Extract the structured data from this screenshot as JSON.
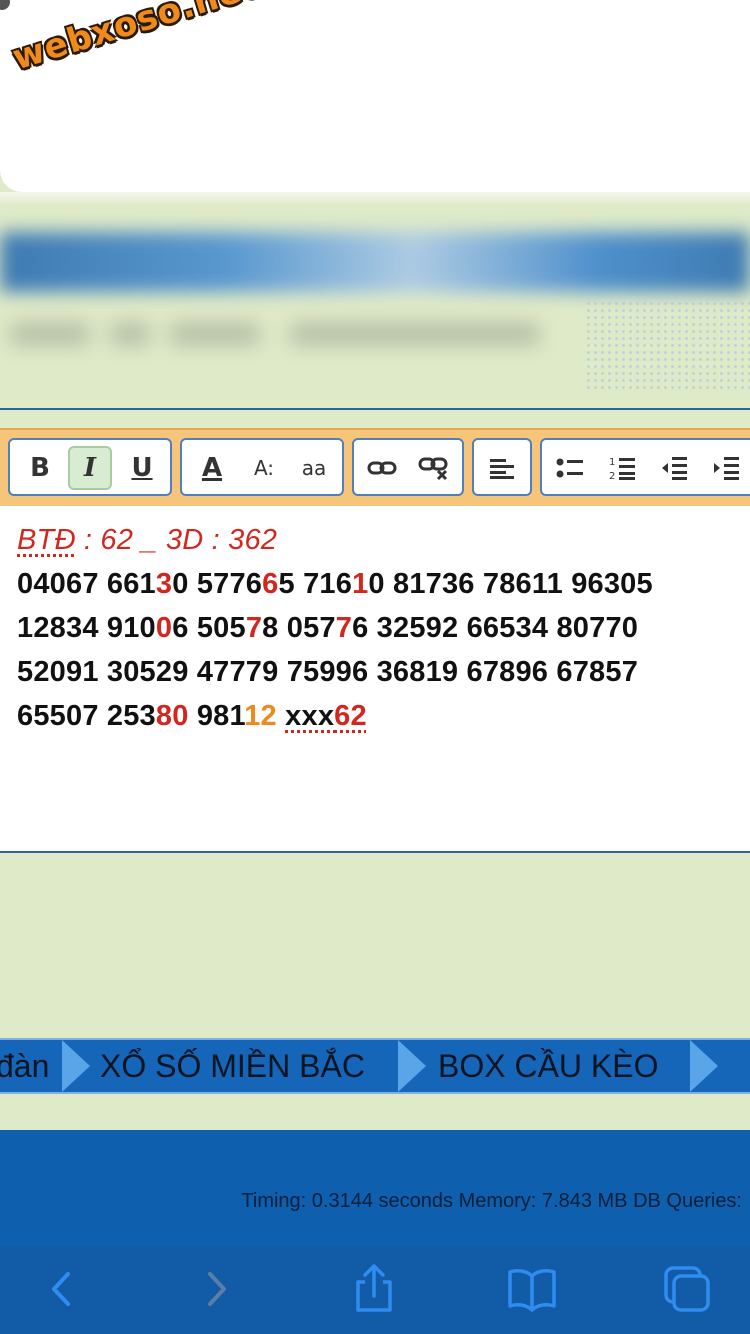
{
  "header": {
    "logo_text": "webxoso.net"
  },
  "toolbar": {
    "groups": [
      {
        "name": "text-style",
        "buttons": [
          {
            "label": "B",
            "icon": "bold-icon"
          },
          {
            "label": "I",
            "icon": "italic-icon",
            "active": true
          },
          {
            "label": "U",
            "icon": "underline-icon"
          }
        ]
      },
      {
        "name": "font",
        "buttons": [
          {
            "label": "A",
            "icon": "font-color-icon"
          },
          {
            "label": "A:",
            "icon": "font-size-icon"
          },
          {
            "label": "aa",
            "icon": "font-family-icon"
          }
        ]
      },
      {
        "name": "link",
        "buttons": [
          {
            "icon": "link-icon"
          },
          {
            "icon": "unlink-icon"
          }
        ]
      },
      {
        "name": "align",
        "buttons": [
          {
            "icon": "align-left-icon"
          }
        ]
      },
      {
        "name": "list",
        "buttons": [
          {
            "icon": "bullet-list-icon"
          },
          {
            "icon": "numbered-list-icon"
          },
          {
            "icon": "outdent-icon"
          },
          {
            "icon": "indent-icon"
          }
        ]
      }
    ]
  },
  "editor": {
    "header_line": {
      "btd": "BTĐ",
      "rest": " : 62 _ 3D : 362"
    },
    "line1": {
      "a": "04067 661",
      "b": "3",
      "c": "0 5776",
      "d": "6",
      "e": "5 716",
      "f": "1",
      "g": "0 81736 78611 96305"
    },
    "line2": {
      "a": "12834 910",
      "b": "0",
      "c": "6 505",
      "d": "7",
      "e": "8 057",
      "f": "7",
      "g": "6 32592 66534 80770"
    },
    "line3": "52091 30529 47779 75996 36819 67896 67857",
    "line4": {
      "a": "65507 253",
      "b": "80",
      "c": " 981",
      "d": "12",
      "e": " ",
      "f": "xxx",
      "g": "62"
    },
    "colors": {
      "highlight_red": "#d3261f",
      "highlight_orange": "#ec8a1e"
    }
  },
  "nav": {
    "items": [
      {
        "label": "đàn"
      },
      {
        "label": "XỔ SỐ MIỀN BẮC"
      },
      {
        "label": "BOX CẦU KÈO"
      }
    ]
  },
  "footer": {
    "timing_text": "Timing: 0.3144 seconds Memory: 7.843 MB DB Queries:"
  },
  "browser_bar": {
    "buttons": [
      "back-icon",
      "forward-icon",
      "share-icon",
      "bookmarks-icon",
      "tabs-icon"
    ]
  },
  "theme": {
    "page_bg": "#dfeac8",
    "toolbar_bg": "#f6c57a",
    "nav_bg": "#1565b8",
    "footer_bg": "#0e5fae"
  }
}
